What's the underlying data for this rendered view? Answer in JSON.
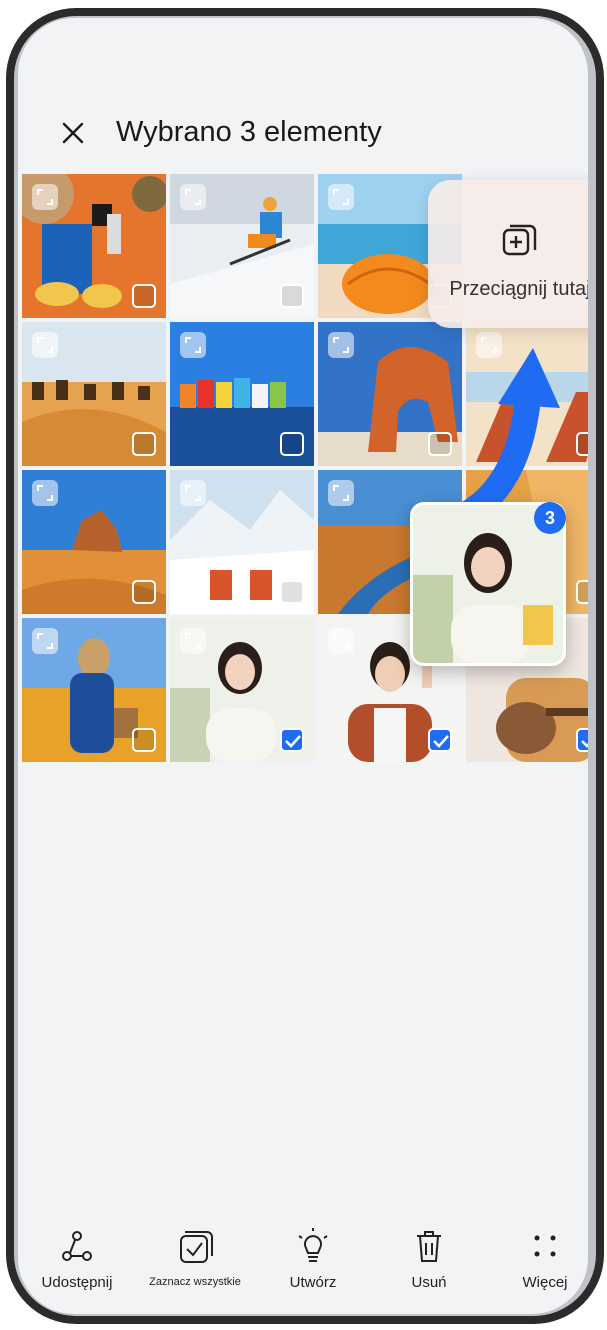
{
  "header": {
    "close_icon": "close-icon",
    "title": "Wybrano 3 elementy"
  },
  "drop_zone": {
    "icon": "add-to-album-icon",
    "label": "Przeciągnij tutaj"
  },
  "drag": {
    "count_badge": "3"
  },
  "photos": [
    {
      "scene": "beach-accessories",
      "selected": false
    },
    {
      "scene": "skier-snow",
      "selected": false
    },
    {
      "scene": "beach-umbrella",
      "selected": false
    },
    {
      "scene": "sky-white",
      "selected": false
    },
    {
      "scene": "desert-camels",
      "selected": false
    },
    {
      "scene": "colorful-houses",
      "selected": false
    },
    {
      "scene": "rock-arch",
      "selected": false
    },
    {
      "scene": "beach-chairs",
      "selected": false
    },
    {
      "scene": "desert-rock",
      "selected": false
    },
    {
      "scene": "snow-mountain-chairs",
      "selected": false
    },
    {
      "scene": "river-desert",
      "selected": false
    },
    {
      "scene": "chairs-orange",
      "selected": false
    },
    {
      "scene": "woman-flower-field",
      "selected": false
    },
    {
      "scene": "woman-portrait",
      "selected": true
    },
    {
      "scene": "man-peace-sign",
      "selected": true
    },
    {
      "scene": "woman-guitar",
      "selected": true
    }
  ],
  "toolbar": {
    "share_label": "Udostępnij",
    "select_all_label": "Zaznacz wszystkie",
    "create_label": "Utwórz",
    "delete_label": "Usuń",
    "more_label": "Więcej"
  },
  "colors": {
    "accent": "#1f6cf3",
    "background": "#f1f3f5",
    "drop_zone": "#f6ece8"
  }
}
